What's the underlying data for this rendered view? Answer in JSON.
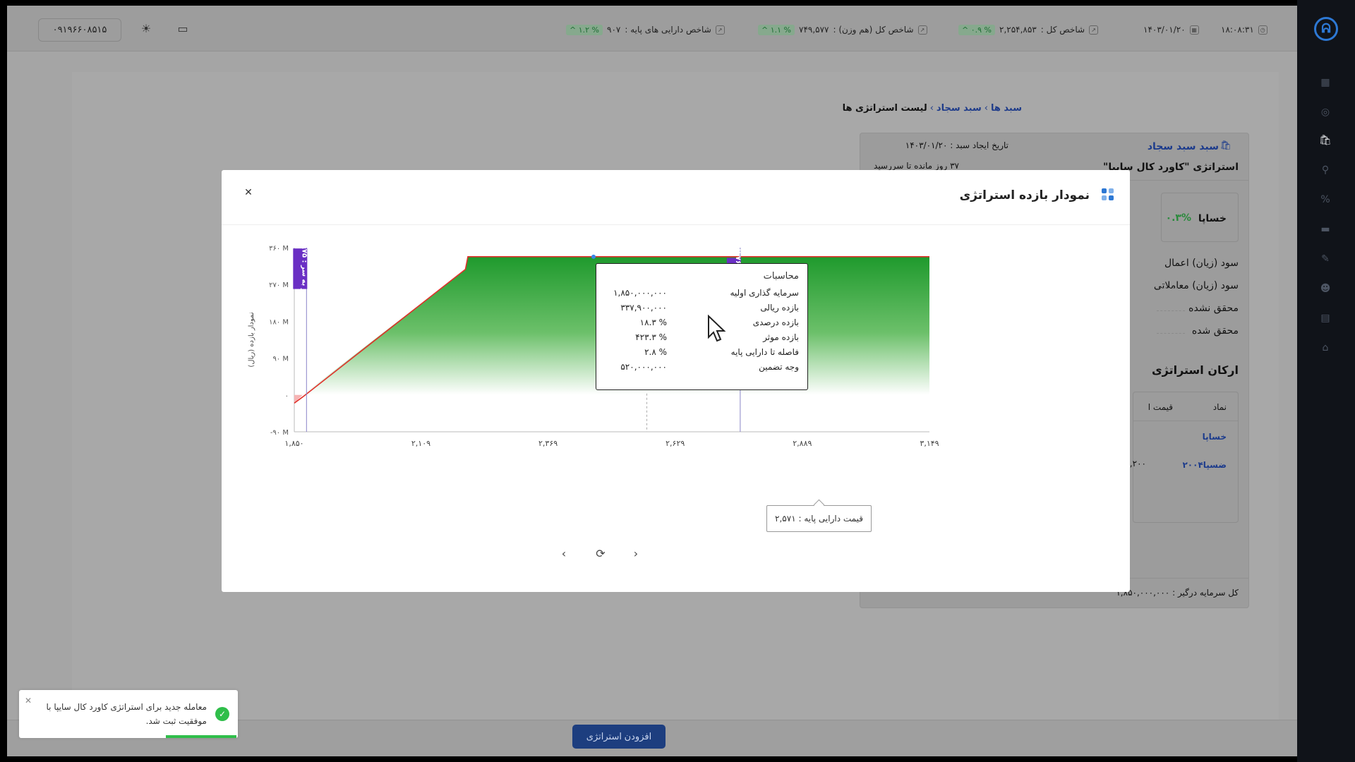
{
  "top_bar": {
    "phone": "۰۹۱۹۶۶۰۸۵۱۵",
    "time": "۱۸:۰۸:۳۱",
    "date": "۱۴۰۳/۰۱/۲۰",
    "total_index": {
      "label": "شاخص کل :",
      "value": "۲,۲۵۴,۸۵۳",
      "change": "% ۰.۹ ^"
    },
    "equal_weight_index": {
      "label": "شاخص کل (هم وزن) :",
      "value": "۷۴۹,۵۷۷",
      "change": "% ۱.۱ ^"
    },
    "base_asset_index": {
      "label": "شاخص دارایی های پایه :",
      "value": "۹۰۷",
      "change": "% ۱.۲ ^"
    }
  },
  "breadcrumb": {
    "item1": "سبد ها",
    "item2": "سبد سجاد",
    "current": "لیست استراتژی ها"
  },
  "side_card": {
    "basket_name": "سبد سبد سجاد",
    "created_date": "تاریخ ایجاد سبد : ۱۴۰۳/۰۱/۲۰",
    "strategy_name": "استراتژی \"کاورد کال سایپا\"",
    "days_remaining": "۳۷ روز مانده تا سررسید",
    "symbol": "خساپا",
    "symbol_change": "۰.۳%",
    "pnl_exercise": "سود (زیان) اعمال",
    "pnl_trading": "سود (زیان) معاملاتی",
    "unrealized": "محقق نشده",
    "realized": "محقق شده",
    "components_title": "ارکان استراتژی",
    "col_symbol": "نماد",
    "col_price": "قیمت ا",
    "row1_symbol": "خساپا",
    "row2_symbol": "ضسپا۲۰۰۴",
    "row2_price": "۲,۲۰۰",
    "total_investment": "کل سرمایه درگیر : ۱,۸۵۰,۰۰۰,۰۰۰"
  },
  "modal": {
    "title": "نمودار بازده استراتژی",
    "close_glyph": "✕",
    "tooltip": {
      "title": "محاسبات",
      "rows": [
        {
          "label": "سرمایه گذاری اولیه",
          "value": "۱,۸۵۰,۰۰۰,۰۰۰"
        },
        {
          "label": "بازده ریالی",
          "value": "۳۳۷,۹۰۰,۰۰۰"
        },
        {
          "label": "بازده درصدی",
          "value": "۱۸.۳ %"
        },
        {
          "label": "بازده موثر",
          "value": "۴۲۳.۳ %"
        },
        {
          "label": "فاصله تا دارایی پایه",
          "value": "۲.۸ %"
        },
        {
          "label": "وجه تضمین",
          "value": "۵۲۰,۰۰۰,۰۰۰"
        }
      ]
    },
    "base_price_label": "قیمت دارایی پایه : ۲,۵۷۱",
    "nav": {
      "prev": "‹",
      "refresh": "⟳",
      "next": "›"
    }
  },
  "chart_data": {
    "type": "area",
    "ylabel": "نمودار بازده (ریال)",
    "y_ticks": [
      "-۹۰ M",
      "۰",
      "۹۰ M",
      "۱۸۰ M",
      "۲۷۰ M",
      "۳۶۰ M"
    ],
    "y_values": [
      -90,
      0,
      90,
      180,
      270,
      360
    ],
    "x_ticks": [
      "۱,۸۵۰",
      "۲,۱۰۹",
      "۲,۳۶۹",
      "۲,۶۲۹",
      "۲,۸۸۹",
      "۳,۱۴۹"
    ],
    "x_values": [
      1850,
      2109,
      2369,
      2629,
      2889,
      3149
    ],
    "xlim": [
      1850,
      3149
    ],
    "ylim": [
      -90,
      360
    ],
    "series": [
      {
        "x": [
          1850,
          1867,
          2200,
          2205,
          3149
        ],
        "y": [
          -20,
          -5,
          307,
          337.9,
          337.9
        ]
      }
    ],
    "markers": [
      {
        "label": "سر به سر : ۱,۸۷۵",
        "x": 1875,
        "y_top": 358,
        "y_bottom": 259,
        "color": "#6a2fc4"
      },
      {
        "label": "زمان ثبت : ۲,۷۶۲",
        "x": 2762,
        "y_top": 335,
        "y_bottom": 231,
        "color": "#6a2fc4"
      }
    ],
    "current_price": 2571,
    "colors": {
      "line": "#e0302a",
      "area_top": "#1f9a2d",
      "area_bottom": "#ffffff",
      "loss": "#f6b4b4"
    }
  },
  "bottom_bar": {
    "add_strategy": "افزودن استراتژی"
  },
  "toast": {
    "message": "معامله جدید برای استراتژی کاورد کال سایپا با موفقیت ثبت شد.",
    "close_glyph": "✕",
    "check_glyph": "✓"
  }
}
